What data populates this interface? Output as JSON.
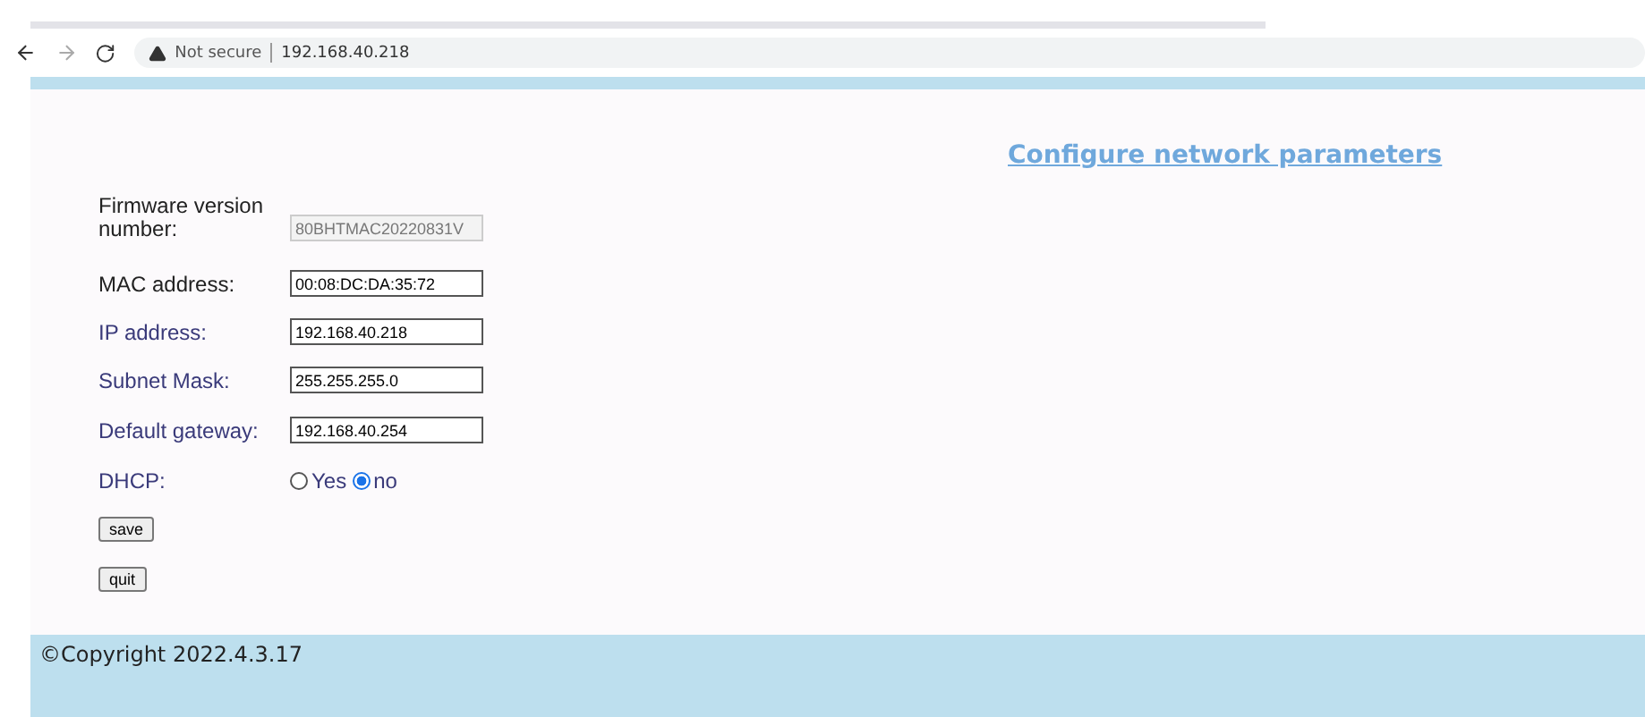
{
  "browser": {
    "security": "Not secure",
    "address": "192.168.40.218"
  },
  "heading": "Configure network parameters",
  "fields": [
    {
      "label": "Firmware version number:",
      "value": "80BHTMAC20220831V",
      "disabled": true,
      "color": "#222222"
    },
    {
      "label": "MAC address:",
      "value": "00:08:DC:DA:35:72",
      "disabled": false,
      "color": "#222222"
    },
    {
      "label": "IP address:",
      "value": "192.168.40.218",
      "disabled": false,
      "color": "#3a3a7a"
    },
    {
      "label": "Subnet Mask:",
      "value": "255.255.255.0",
      "disabled": false,
      "color": "#3a3a7a"
    },
    {
      "label": "Default gateway:",
      "value": "192.168.40.254",
      "disabled": false,
      "color": "#3a3a7a"
    }
  ],
  "dhcp": {
    "label": "DHCP:",
    "color": "#3a3a7a",
    "options": [
      {
        "label": "Yes",
        "selected": false
      },
      {
        "label": "no",
        "selected": true
      }
    ]
  },
  "buttons": [
    "save",
    "quit"
  ],
  "footer": "©Copyright 2022.4.3.17"
}
